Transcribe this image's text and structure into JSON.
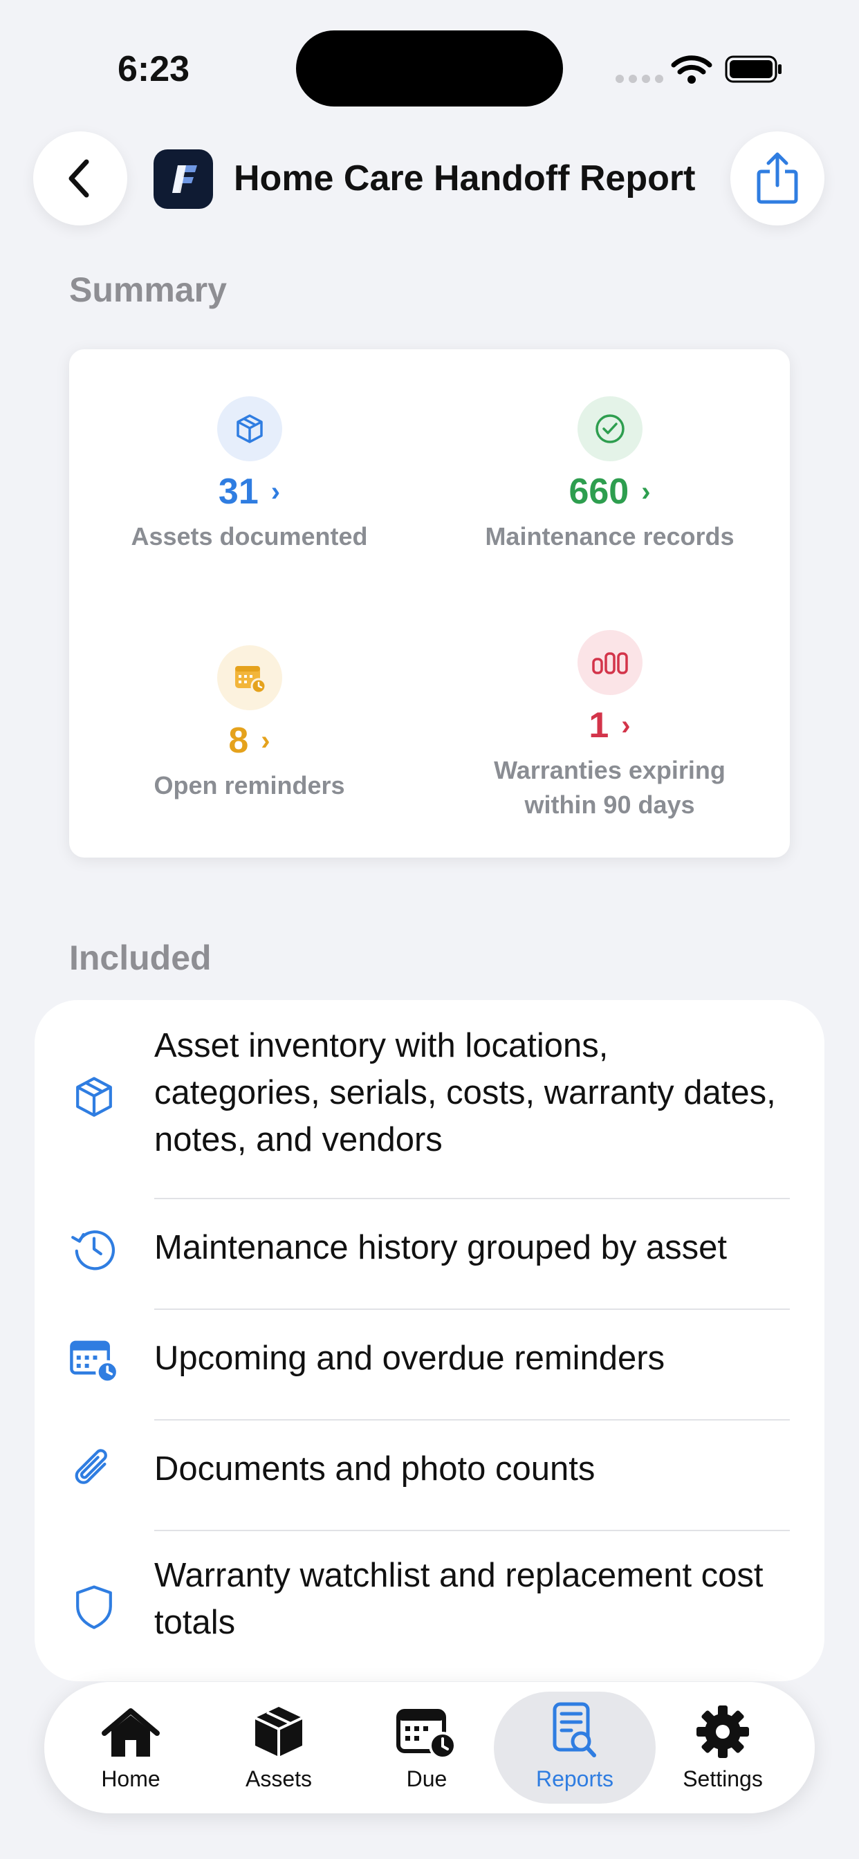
{
  "status_bar": {
    "time": "6:23"
  },
  "header": {
    "title": "Home Care Handoff Report"
  },
  "summary": {
    "title": "Summary",
    "stats": [
      {
        "value": "31",
        "label": "Assets documented",
        "color": "#2f7de1",
        "icon": "box-icon"
      },
      {
        "value": "660",
        "label": "Maintenance records",
        "color": "#2e9e4f",
        "icon": "check-circle-icon"
      },
      {
        "value": "8",
        "label": "Open reminders",
        "color": "#e5a21c",
        "icon": "calendar-clock-icon"
      },
      {
        "value": "1",
        "label": "Warranties expiring within 90 days",
        "color": "#d3344a",
        "icon": "bar-chart-icon"
      }
    ]
  },
  "included": {
    "title": "Included",
    "items": [
      {
        "text": "Asset inventory with locations, categories, serials, costs, warranty dates, notes, and vendors",
        "icon": "box-icon"
      },
      {
        "text": "Maintenance history grouped by asset",
        "icon": "history-icon"
      },
      {
        "text": "Upcoming and overdue reminders",
        "icon": "calendar-clock-icon"
      },
      {
        "text": "Documents and photo counts",
        "icon": "paperclip-icon"
      },
      {
        "text": "Warranty watchlist and replacement cost totals",
        "icon": "shield-icon"
      }
    ]
  },
  "tabbar": {
    "active": "Reports",
    "tabs": [
      {
        "label": "Home",
        "icon": "house-icon"
      },
      {
        "label": "Assets",
        "icon": "cube-icon"
      },
      {
        "label": "Due",
        "icon": "calendar-clock-icon"
      },
      {
        "label": "Reports",
        "icon": "report-search-icon"
      },
      {
        "label": "Settings",
        "icon": "gear-icon"
      }
    ]
  },
  "colors": {
    "accent": "#2f7de1",
    "background": "#f2f3f7"
  }
}
